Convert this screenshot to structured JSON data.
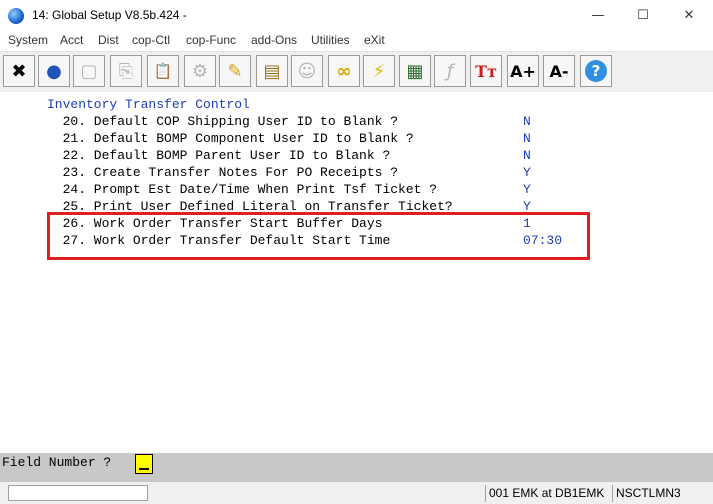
{
  "window": {
    "title": "14: Global Setup V8.5b.424 -",
    "minimize": "—",
    "maximize": "☐",
    "close": "✕"
  },
  "menu": [
    "System",
    "Acct",
    "Dist",
    "cop-Ctl",
    "cop-Func",
    "add-Ons",
    "Utilities",
    "eXit"
  ],
  "toolbar": [
    {
      "name": "close-x-icon",
      "glyph": "✖"
    },
    {
      "name": "globe-icon",
      "glyph": "●"
    },
    {
      "name": "blank-icon",
      "glyph": "▢"
    },
    {
      "name": "copy-icon",
      "glyph": "⎘"
    },
    {
      "name": "paste-icon",
      "glyph": "📋"
    },
    {
      "name": "gear-icon",
      "glyph": "⚙"
    },
    {
      "name": "pencil-icon",
      "glyph": "✎"
    },
    {
      "name": "notepad-icon",
      "glyph": "▤"
    },
    {
      "name": "users-icon",
      "glyph": "☺"
    },
    {
      "name": "link-icon",
      "glyph": "∞"
    },
    {
      "name": "lightning-icon",
      "glyph": "⚡"
    },
    {
      "name": "form-icon",
      "glyph": "▦"
    },
    {
      "name": "function-icon",
      "glyph": "ƒ"
    },
    {
      "name": "font-icon",
      "glyph": "Tт"
    },
    {
      "name": "font-larger-icon",
      "glyph": "A+"
    },
    {
      "name": "font-smaller-icon",
      "glyph": "A-"
    },
    {
      "name": "help-icon",
      "glyph": "?"
    }
  ],
  "screen": {
    "header": "Inventory Transfer Control",
    "rows": [
      {
        "text": "  20. Default COP Shipping User ID to Blank ?",
        "value": "N"
      },
      {
        "text": "  21. Default BOMP Component User ID to Blank ?",
        "value": "N"
      },
      {
        "text": "  22. Default BOMP Parent User ID to Blank ?",
        "value": "N"
      },
      {
        "text": "  23. Create Transfer Notes For PO Receipts ?",
        "value": "Y"
      },
      {
        "text": "  24. Prompt Est Date/Time When Print Tsf Ticket ?",
        "value": "Y"
      },
      {
        "text": "  25. Print User Defined Literal on Transfer Ticket?",
        "value": "Y"
      },
      {
        "text": "  26. Work Order Transfer Start Buffer Days",
        "value": "1"
      },
      {
        "text": "  27. Work Order Transfer Default Start Time",
        "value": "07:30"
      }
    ]
  },
  "command": {
    "label": "Field Number ?"
  },
  "status": {
    "session": "001 EMK at DB1EMK",
    "program": "NSCTLMN3"
  }
}
